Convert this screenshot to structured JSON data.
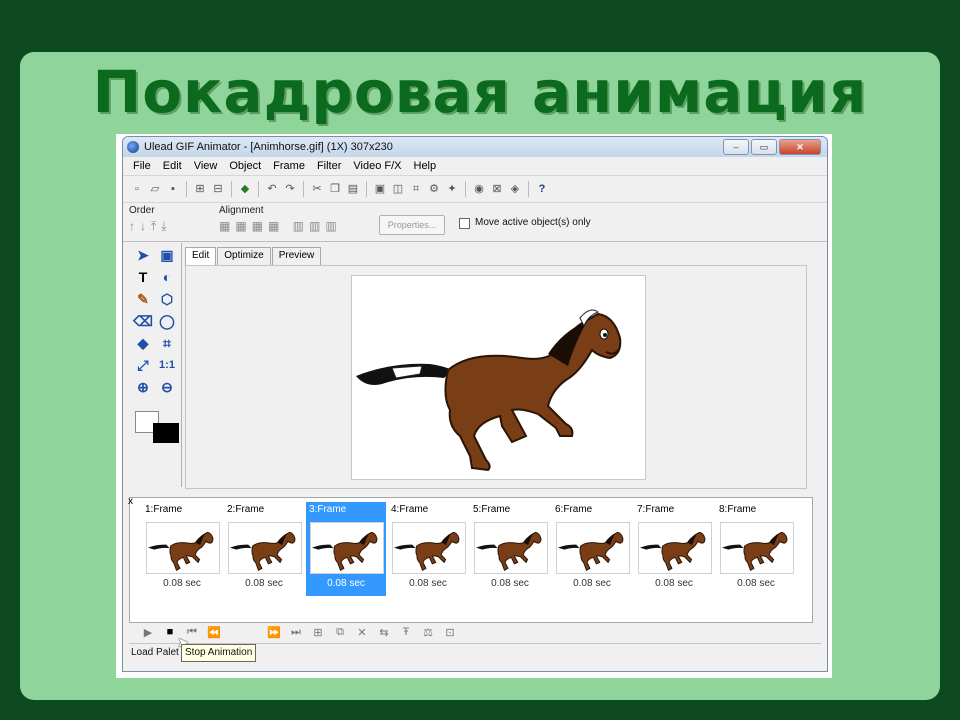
{
  "slide": {
    "title": "Покадровая анимация"
  },
  "window": {
    "title": "Ulead GIF Animator - [Animhorse.gif] (1X) 307x230",
    "controls": {
      "minimize": "–",
      "maximize": "▭",
      "close": "✕"
    }
  },
  "menu": [
    "File",
    "Edit",
    "View",
    "Object",
    "Frame",
    "Filter",
    "Video F/X",
    "Help"
  ],
  "options": {
    "order_label": "Order",
    "alignment_label": "Alignment",
    "properties_button": "Properties...",
    "move_active_label": "Move active object(s) only"
  },
  "tools": {
    "text_glyph": "T",
    "ratio_glyph": "1:1"
  },
  "tabs": [
    "Edit",
    "Optimize",
    "Preview"
  ],
  "frames": [
    {
      "label": "1:Frame",
      "delay": "0.08 sec"
    },
    {
      "label": "2:Frame",
      "delay": "0.08 sec"
    },
    {
      "label": "3:Frame",
      "delay": "0.08 sec"
    },
    {
      "label": "4:Frame",
      "delay": "0.08 sec"
    },
    {
      "label": "5:Frame",
      "delay": "0.08 sec"
    },
    {
      "label": "6:Frame",
      "delay": "0.08 sec"
    },
    {
      "label": "7:Frame",
      "delay": "0.08 sec"
    },
    {
      "label": "8:Frame",
      "delay": "0.08 sec"
    }
  ],
  "selected_frame": 3,
  "panel_close": "x",
  "status": {
    "text": "Load Palet",
    "tooltip": "Stop Animation"
  },
  "colors": {
    "slide_bg": "#8fd49a",
    "page_bg": "#0d4a1e",
    "title_color": "#0b6a1e",
    "selection": "#3399ff",
    "horse": "#7a3e16"
  }
}
